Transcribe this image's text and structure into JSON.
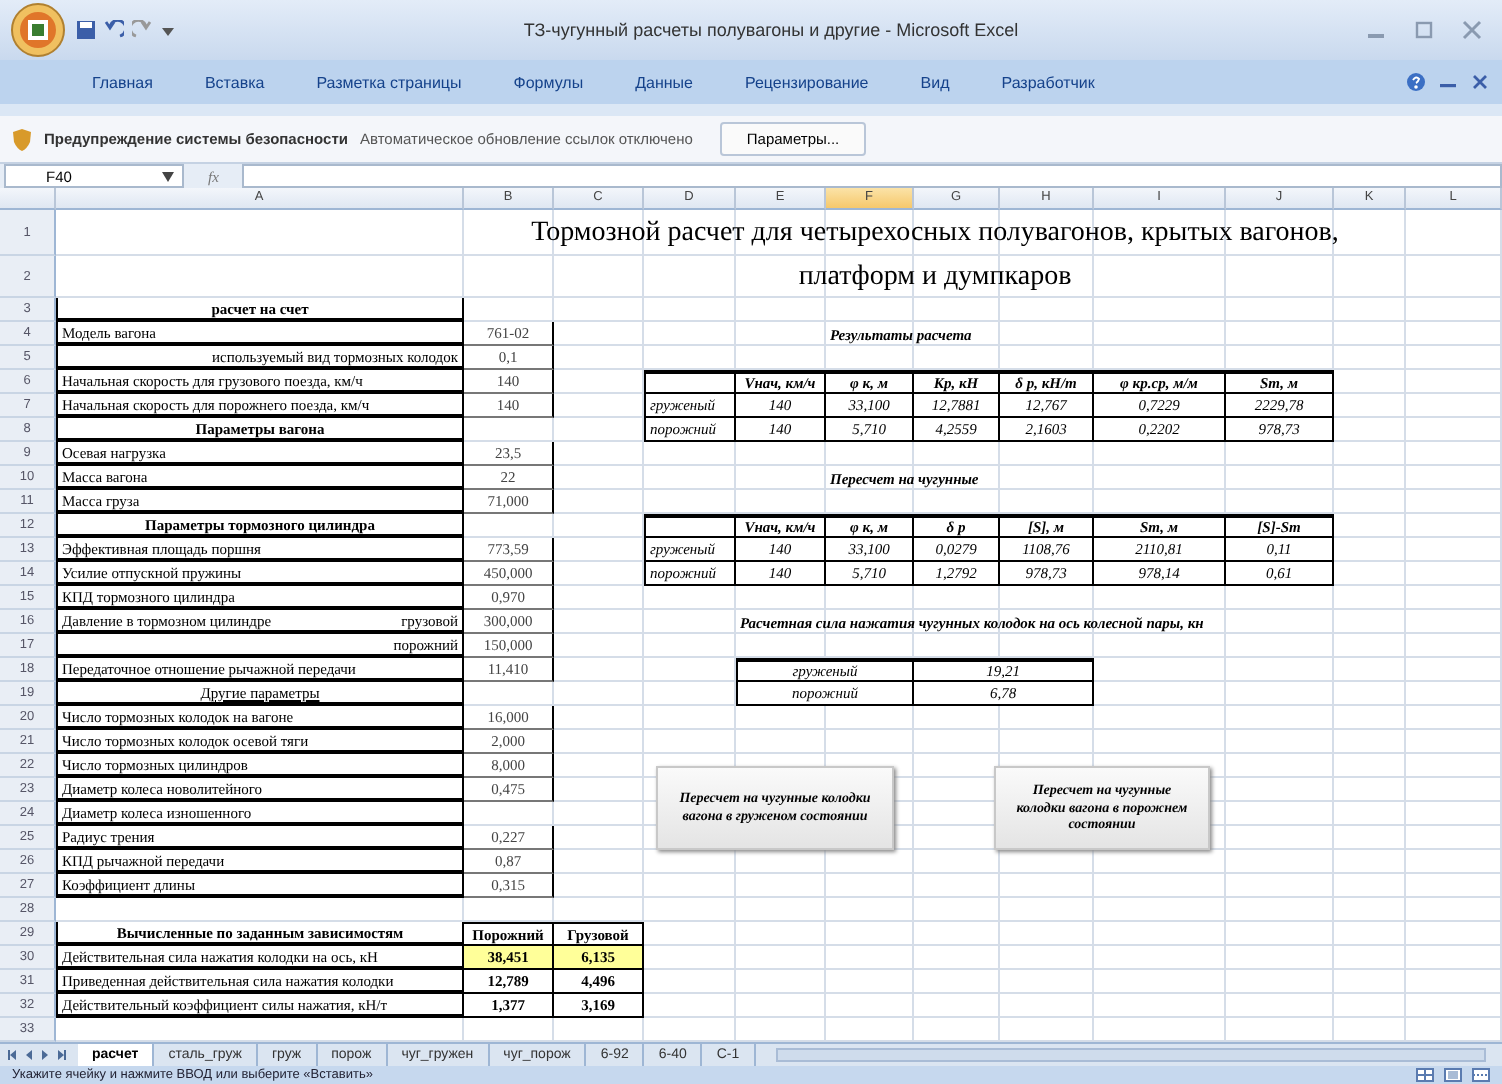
{
  "window": {
    "title": "ТЗ-чугунный расчеты полувагоны и другие - Microsoft Excel"
  },
  "ribbon": {
    "tabs": [
      {
        "label": "Главная",
        "selected": false
      },
      {
        "label": "Вставка",
        "selected": false
      },
      {
        "label": "Разметка страницы",
        "selected": false
      },
      {
        "label": "Формулы",
        "selected": false
      },
      {
        "label": "Данные",
        "selected": false
      },
      {
        "label": "Рецензирование",
        "selected": false
      },
      {
        "label": "Вид",
        "selected": false
      },
      {
        "label": "Разработчик",
        "selected": false
      }
    ]
  },
  "security_bar": {
    "title": "Предупреждение системы безопасности",
    "message": "Автоматическое обновление ссылок отключено",
    "button": "Параметры..."
  },
  "formula_bar": {
    "name_box": "F40",
    "fx": "fx"
  },
  "sheet": {
    "columns": [
      {
        "label": "A",
        "selected": false
      },
      {
        "label": "B",
        "selected": false
      },
      {
        "label": "C",
        "selected": false
      },
      {
        "label": "D",
        "selected": false
      },
      {
        "label": "E",
        "selected": false
      },
      {
        "label": "F",
        "selected": true
      },
      {
        "label": "G",
        "selected": false
      },
      {
        "label": "H",
        "selected": false
      },
      {
        "label": "I",
        "selected": false
      },
      {
        "label": "J",
        "selected": false
      },
      {
        "label": "K",
        "selected": false
      },
      {
        "label": "L",
        "selected": false
      }
    ],
    "row_numbers": [
      "1",
      "2",
      "3",
      "4",
      "5",
      "6",
      "7",
      "8",
      "9",
      "10",
      "11",
      "12",
      "13",
      "14",
      "15",
      "16",
      "17",
      "18",
      "19",
      "20",
      "21",
      "22",
      "23",
      "24",
      "25",
      "26",
      "27",
      "28",
      "29",
      "30",
      "31",
      "32",
      "33"
    ],
    "title": [
      "Тормозной расчет для четырехосных полувагонов, крытых вагонов,",
      "платформ и думпкаров"
    ],
    "parameters": [
      {
        "kind": "section",
        "label": "расчет на счет"
      },
      {
        "kind": "label",
        "label": "Модель вагона",
        "value": "761-02"
      },
      {
        "kind": "sublabel",
        "label": "используемый вид тормозных колодок",
        "value": "0,1"
      },
      {
        "kind": "label",
        "label": "Начальная скорость для грузового поезда, км/ч",
        "value": "140"
      },
      {
        "kind": "label",
        "label": "Начальная скорость для порожнего поезда, км/ч",
        "value": "140"
      },
      {
        "kind": "section",
        "label": "Параметры вагона"
      },
      {
        "kind": "label",
        "label": "Осевая нагрузка",
        "value": "23,5"
      },
      {
        "kind": "label",
        "label": "Масса вагона",
        "value": "22"
      },
      {
        "kind": "label",
        "label": "Масса груза",
        "value": "71,000"
      },
      {
        "kind": "section",
        "label": "Параметры тормозного цилиндра"
      },
      {
        "kind": "label",
        "label": "Эффективная площадь поршня",
        "value": "773,59"
      },
      {
        "kind": "label",
        "label": "Усилие отпускной пружины",
        "value": "450,000"
      },
      {
        "kind": "label",
        "label": "КПД тормозного цилиндра",
        "value": "0,970"
      },
      {
        "kind": "label",
        "label": "Давление в тормозном цилиндре",
        "aside": "грузовой",
        "value": "300,000"
      },
      {
        "kind": "sublabel",
        "label": "порожний",
        "value": "150,000"
      },
      {
        "kind": "label",
        "label": "Передаточное отношение рычажной передачи",
        "value": "11,410"
      },
      {
        "kind": "subsection",
        "label": "Другие параметры"
      },
      {
        "kind": "label",
        "label": "Число тормозных колодок на вагоне",
        "value": "16,000"
      },
      {
        "kind": "label",
        "label": "Число тормозных колодок осевой тяги",
        "value": "2,000"
      },
      {
        "kind": "label",
        "label": "Число тормозных цилиндров",
        "value": "8,000"
      },
      {
        "kind": "label",
        "label": "Диаметр колеса новолитейного",
        "value": "0,475"
      },
      {
        "kind": "label",
        "label": "Диаметр колеса изношенного"
      },
      {
        "kind": "label",
        "label": "Радиус трения",
        "value": "0,227"
      },
      {
        "kind": "label",
        "label": "КПД рычажной передачи",
        "value": "0,87"
      },
      {
        "kind": "label",
        "label": "Коэффициент длины",
        "value": "0,315"
      }
    ],
    "computed": {
      "heading": "Вычисленные по заданным зависимостям",
      "columns": [
        "Порожний",
        "Грузовой"
      ],
      "rows": [
        {
          "label": "Действительная сила нажатия колодки на ось, кН",
          "values": [
            "38,451",
            "6,135"
          ],
          "highlighted": true
        },
        {
          "label": "Приведенная действительная сила нажатия колодки",
          "values": [
            "12,789",
            "4,496"
          ],
          "highlighted": false
        },
        {
          "label": "Действительный коэффициент силы нажатия, кН/т",
          "values": [
            "1,377",
            "3,169"
          ],
          "highlighted": false
        }
      ]
    },
    "results": {
      "caption": "Результаты расчета",
      "columns": [
        "Vнач, км/ч",
        "φ к, м",
        "Кр, кН",
        "δ р, кН/т",
        "φ кр.ср, м/м",
        "Sт, м"
      ],
      "rows": [
        {
          "label": "груженый",
          "values": [
            "140",
            "33,100",
            "12,7881",
            "12,767",
            "0,7229",
            "2229,78"
          ]
        },
        {
          "label": "порожний",
          "values": [
            "140",
            "5,710",
            "4,2559",
            "2,1603",
            "0,2202",
            "978,73"
          ]
        }
      ]
    },
    "recalculation": {
      "caption": "Пересчет на чугунные",
      "columns": [
        "Vнач, км/ч",
        "φ к, м",
        "δ р",
        "[S], м",
        "Sт, м",
        "[S]-Sт"
      ],
      "rows": [
        {
          "label": "груженый",
          "values": [
            "140",
            "33,100",
            "0,0279",
            "1108,76",
            "2110,81",
            "0,11"
          ]
        },
        {
          "label": "порожний",
          "values": [
            "140",
            "5,710",
            "1,2792",
            "978,73",
            "978,14",
            "0,61"
          ]
        }
      ]
    },
    "pressing_force": {
      "caption": "Расчетная сила нажатия чугунных колодок на ось колесной пары, кн",
      "rows": [
        {
          "label": "груженый",
          "value": "19,21"
        },
        {
          "label": "порожний",
          "value": "6,78"
        }
      ]
    },
    "buttons": [
      {
        "text": "Пересчет на чугунные колодки вагона в груженом состоянии"
      },
      {
        "text": "Пересчет на чугунные колодки вагона в порожнем состоянии"
      }
    ]
  },
  "sheet_tabs": [
    {
      "label": "расчет",
      "selected": true
    },
    {
      "label": "сталь_груж",
      "selected": false
    },
    {
      "label": "груж",
      "selected": false
    },
    {
      "label": "порож",
      "selected": false
    },
    {
      "label": "чуг_гружен",
      "selected": false
    },
    {
      "label": "чуг_порож",
      "selected": false
    },
    {
      "label": "6-92",
      "selected": false
    },
    {
      "label": "6-40",
      "selected": false
    },
    {
      "label": "С-1",
      "selected": false
    }
  ],
  "status_bar": {
    "text": "Укажите ячейку и нажмите ВВОД или выберите «Вставить»"
  }
}
